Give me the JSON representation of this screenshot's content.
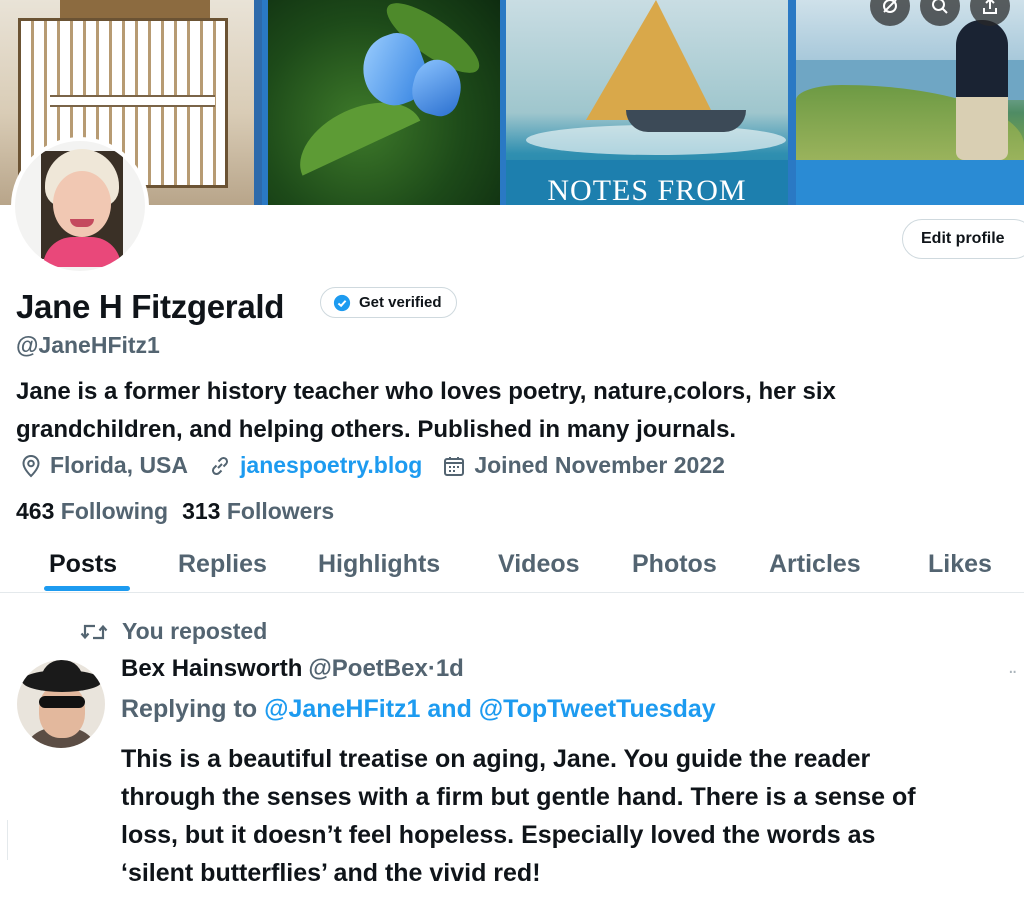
{
  "banner": {
    "book_text": "NOTES FROM"
  },
  "header": {
    "icons": [
      "no-notifications-icon",
      "search-icon",
      "share-icon"
    ],
    "edit_profile_label": "Edit profile"
  },
  "profile": {
    "display_name": "Jane H Fitzgerald",
    "get_verified_label": "Get verified",
    "handle": "@JaneHFitz1",
    "bio_line1": "Jane is a former history teacher who loves poetry, nature,colors, her six",
    "bio_line2": "grandchildren, and helping others. Published in many journals.",
    "location": "Florida, USA",
    "website": "janespoetry.blog",
    "joined": "Joined November 2022",
    "following_count": "463",
    "following_label": "Following",
    "followers_count": "313",
    "followers_label": "Followers"
  },
  "tabs": [
    {
      "label": "Posts",
      "active": true
    },
    {
      "label": "Replies",
      "active": false
    },
    {
      "label": "Highlights",
      "active": false
    },
    {
      "label": "Videos",
      "active": false
    },
    {
      "label": "Photos",
      "active": false
    },
    {
      "label": "Articles",
      "active": false
    },
    {
      "label": "Likes",
      "active": false
    }
  ],
  "tweet": {
    "repost_label": "You reposted",
    "author_name": "Bex Hainsworth",
    "author_handle": "@PoetBex",
    "separator": "·",
    "time": "1d",
    "replying_prefix": "Replying to",
    "mention1": "@JaneHFitz1",
    "and_word": "and",
    "mention2": "@TopTweetTuesday",
    "body_line1": "This is a beautiful treatise on aging, Jane. You guide the reader",
    "body_line2": "through the senses with a firm but gentle hand. There is a sense of",
    "body_line3": "loss, but it doesn’t feel hopeless. Especially loved the words as",
    "body_line4": "‘silent butterflies’ and the vivid red!"
  },
  "colors": {
    "accent": "#1d9bf0",
    "text_primary": "#0f1419",
    "text_secondary": "#536471"
  }
}
